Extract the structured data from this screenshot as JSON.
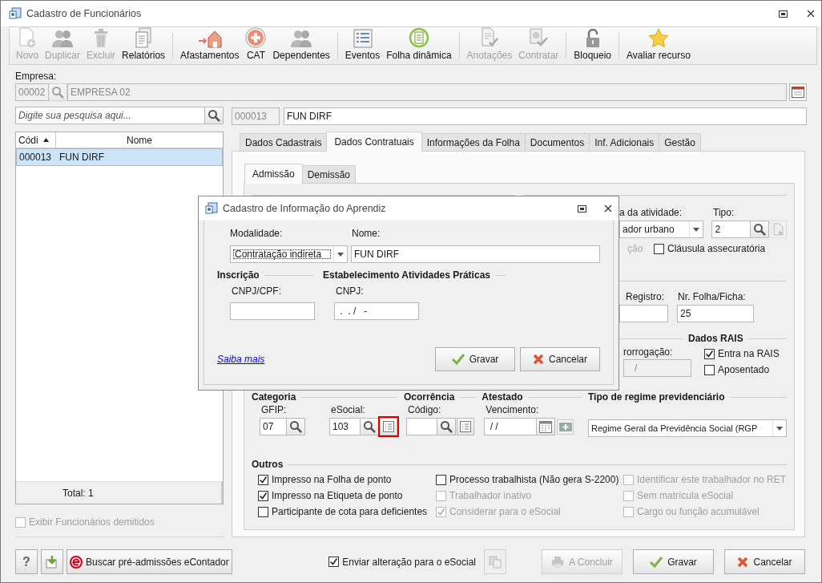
{
  "window": {
    "title": "Cadastro de Funcionários"
  },
  "toolbar": [
    [
      {
        "label": "Novo",
        "kind": "new",
        "disabled": true
      },
      {
        "label": "Duplicar",
        "kind": "people",
        "disabled": true
      },
      {
        "label": "Excluir",
        "kind": "trash",
        "disabled": true
      },
      {
        "label": "Relatórios",
        "kind": "pages",
        "disabled": false
      }
    ],
    [
      {
        "label": "Afastamentos",
        "kind": "house",
        "disabled": false
      },
      {
        "label": "CAT",
        "kind": "cross",
        "disabled": false
      },
      {
        "label": "Dependentes",
        "kind": "people",
        "disabled": false
      }
    ],
    [
      {
        "label": "Eventos",
        "kind": "list",
        "disabled": false
      },
      {
        "label": "Folha dinâmica",
        "kind": "calc",
        "disabled": false
      }
    ],
    [
      {
        "label": "Anotações",
        "kind": "doccheck",
        "disabled": true
      },
      {
        "label": "Contratar",
        "kind": "gearcheck",
        "disabled": true
      }
    ],
    [
      {
        "label": "Bloqueio",
        "kind": "lock",
        "disabled": false
      }
    ],
    [
      {
        "label": "Avaliar recurso",
        "kind": "star",
        "disabled": false
      }
    ]
  ],
  "empresa": {
    "label": "Empresa:",
    "code": "00002",
    "name": "EMPRESA 02"
  },
  "search": {
    "placeholder": "Digite sua pesquisa aqui..."
  },
  "employee": {
    "code": "000013",
    "name": "FUN DIRF"
  },
  "list": {
    "columns": [
      "Códi",
      "Nome"
    ],
    "rows": [
      {
        "code": "000013",
        "name": "FUN DIRF",
        "selected": true
      }
    ],
    "total": "Total: 1"
  },
  "show_dismissed": {
    "label": "Exibir Funcionários demitidos",
    "checked": false,
    "disabled": true
  },
  "tabs": [
    {
      "label": "Dados Cadastrais",
      "selected": false
    },
    {
      "label": "Dados Contratuais",
      "selected": true
    },
    {
      "label": "Informações da Folha",
      "selected": false
    },
    {
      "label": "Documentos",
      "selected": false
    },
    {
      "label": "Inf. Adicionais",
      "selected": false
    },
    {
      "label": "Gestão",
      "selected": false
    }
  ],
  "subtabs": [
    {
      "label": "Admissão",
      "selected": true
    },
    {
      "label": "Demissão",
      "selected": false
    }
  ],
  "admissao": {
    "activity_label": "a da atividade:",
    "activity_value": "ador urbano",
    "tipo_label": "Tipo:",
    "tipo_value": "2",
    "option_fragment": {
      "label": "ção",
      "disabled": true
    },
    "clausula": {
      "label": "Cláusula assecuratória",
      "checked": false,
      "disabled": false
    },
    "registro_label": "Registro:",
    "folha_label": "Nr. Folha/Ficha:",
    "folha_value": "25",
    "rais_heading": "Dados RAIS",
    "prorrogacao_label": "rorrogação:",
    "prorrogacao_value": "/",
    "rais_checks": [
      {
        "label": "Entra na RAIS",
        "checked": true,
        "disabled": false
      },
      {
        "label": "Aposentado",
        "checked": false,
        "disabled": false
      }
    ]
  },
  "categoria": {
    "heading": "Categoria",
    "gfip_label": "GFIP:",
    "gfip": "07",
    "esocial_label": "eSocial:",
    "esocial": "103",
    "esocial_list_highlighted": true
  },
  "ocorrencia": {
    "heading": "Ocorrência",
    "label": "Código:"
  },
  "atestado": {
    "heading": "Atestado",
    "label": "Vencimento:",
    "value": " / /"
  },
  "regime": {
    "heading": "Tipo de regime previdenciário",
    "value": "Regime Geral da Previdência Social (RGP"
  },
  "outros": {
    "heading": "Outros",
    "checks": [
      {
        "label": "Impresso na Folha de ponto",
        "checked": true,
        "disabled": false
      },
      {
        "label": "Processo trabalhista (Não gera S-2200)",
        "checked": false,
        "disabled": false
      },
      {
        "label": "Identificar este trabalhador no RET",
        "checked": false,
        "disabled": true
      },
      {
        "label": "Impresso na Etiqueta de ponto",
        "checked": true,
        "disabled": false
      },
      {
        "label": "Trabalhador inativo",
        "checked": false,
        "disabled": true
      },
      {
        "label": "Sem matrícula eSocial",
        "checked": false,
        "disabled": true
      },
      {
        "label": "Participante de cota para deficientes",
        "checked": false,
        "disabled": false
      },
      {
        "label": "Considerar para o eSocial",
        "checked": true,
        "disabled": true
      },
      {
        "label": "Cargo ou função acumulável",
        "checked": false,
        "disabled": true
      }
    ]
  },
  "footer": {
    "help": "?",
    "econtador": "Buscar pré-admissões eContador",
    "enviar": {
      "label": "Enviar alteração para o eSocial",
      "checked": true,
      "disabled": false
    },
    "buttons": [
      {
        "label": "A Concluir",
        "kind": "conclude",
        "disabled": true
      },
      {
        "label": "Gravar",
        "kind": "save",
        "disabled": false
      },
      {
        "label": "Cancelar",
        "kind": "cancel",
        "disabled": false
      }
    ]
  },
  "dialog": {
    "title": "Cadastro de Informação do Aprendiz",
    "modalidade_label": "Modalidade:",
    "modalidade": "Contratação indireta",
    "nome_label": "Nome:",
    "nome": "FUN DIRF",
    "inscricao_heading": "Inscrição",
    "cnpj_cpf_label": "CNPJ/CPF:",
    "estab_heading": "Estabelecimento Atividades Práticas",
    "cnpj_label": "CNPJ:",
    "cnpj_value": " .  . /   -",
    "link": "Saiba mais",
    "buttons": [
      {
        "label": "Gravar",
        "kind": "save",
        "disabled": false
      },
      {
        "label": "Cancelar",
        "kind": "cancel",
        "disabled": false
      }
    ]
  }
}
